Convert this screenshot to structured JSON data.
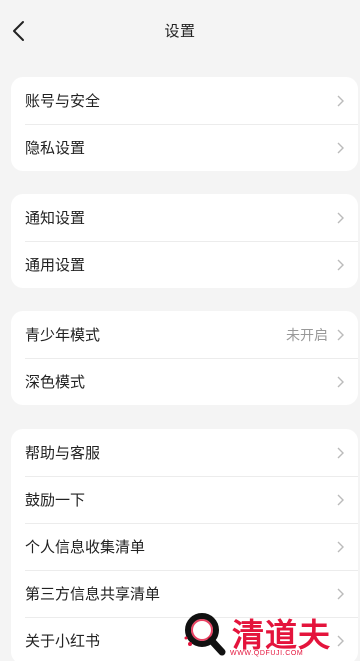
{
  "header": {
    "title": "设置"
  },
  "sections": [
    {
      "items": [
        {
          "label": "账号与安全"
        },
        {
          "label": "隐私设置"
        }
      ]
    },
    {
      "items": [
        {
          "label": "通知设置"
        },
        {
          "label": "通用设置"
        }
      ]
    },
    {
      "items": [
        {
          "label": "青少年模式",
          "value": "未开启"
        },
        {
          "label": "深色模式"
        }
      ]
    },
    {
      "items": [
        {
          "label": "帮助与客服"
        },
        {
          "label": "鼓励一下"
        },
        {
          "label": "个人信息收集清单"
        },
        {
          "label": "第三方信息共享清单"
        },
        {
          "label": "关于小红书"
        }
      ]
    }
  ],
  "watermark": {
    "name": "清道夫",
    "url": "WWW.QDFUJI.COM"
  },
  "colors": {
    "background": "#f4f4f4",
    "card": "#ffffff",
    "text": "#222222",
    "secondary": "#999999",
    "watermark": "#e4143c"
  }
}
